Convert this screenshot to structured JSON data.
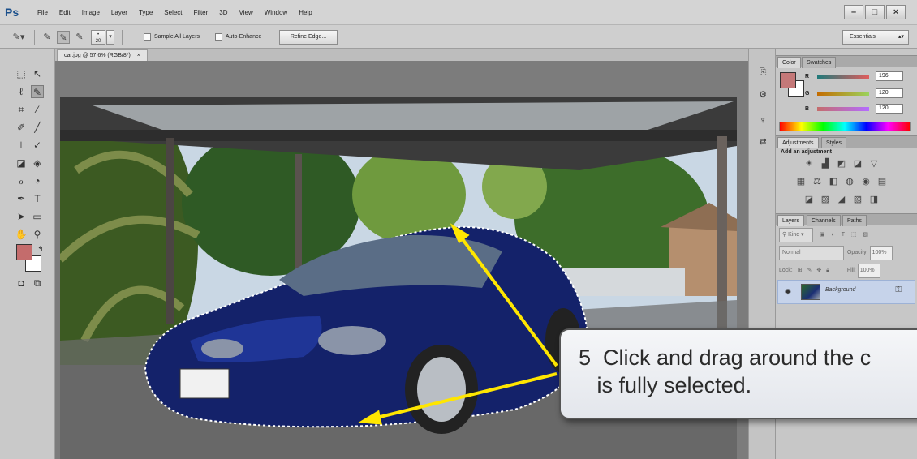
{
  "app": {
    "logo": "Ps",
    "menu": [
      "File",
      "Edit",
      "Image",
      "Layer",
      "Type",
      "Select",
      "Filter",
      "3D",
      "View",
      "Window",
      "Help"
    ],
    "window_buttons": [
      "–",
      "□",
      "×"
    ]
  },
  "options_bar": {
    "brush_size": "20",
    "sample_all_layers_label": "Sample All Layers",
    "auto_enhance_label": "Auto-Enhance",
    "refine_edge_label": "Refine Edge...",
    "workspace_label": "Essentials"
  },
  "document": {
    "tab_label": "car.jpg @ 57.6% (RGB/8*)",
    "tab_close": "×"
  },
  "color_panel": {
    "tabs": [
      "Color",
      "Swatches"
    ],
    "r_label": "R",
    "g_label": "G",
    "b_label": "B",
    "r_value": "196",
    "g_value": "120",
    "b_value": "120",
    "foreground_color": "#c47878",
    "background_color": "#ffffff"
  },
  "adjustments_panel": {
    "tabs": [
      "Adjustments",
      "Styles"
    ],
    "title": "Add an adjustment"
  },
  "layers_panel": {
    "tabs": [
      "Layers",
      "Channels",
      "Paths"
    ],
    "kind_label": "Kind",
    "blend_mode": "Normal",
    "opacity_label": "Opacity:",
    "opacity_value": "100%",
    "lock_label": "Lock:",
    "fill_label": "Fill:",
    "fill_value": "100%",
    "layer_name": "Background"
  },
  "callout": {
    "number": "5",
    "line1": "Click and drag around the c",
    "line2": "is fully selected."
  },
  "colors": {
    "arrow": "#ffe600",
    "selection_layer_bg": "#c6d3ea"
  }
}
